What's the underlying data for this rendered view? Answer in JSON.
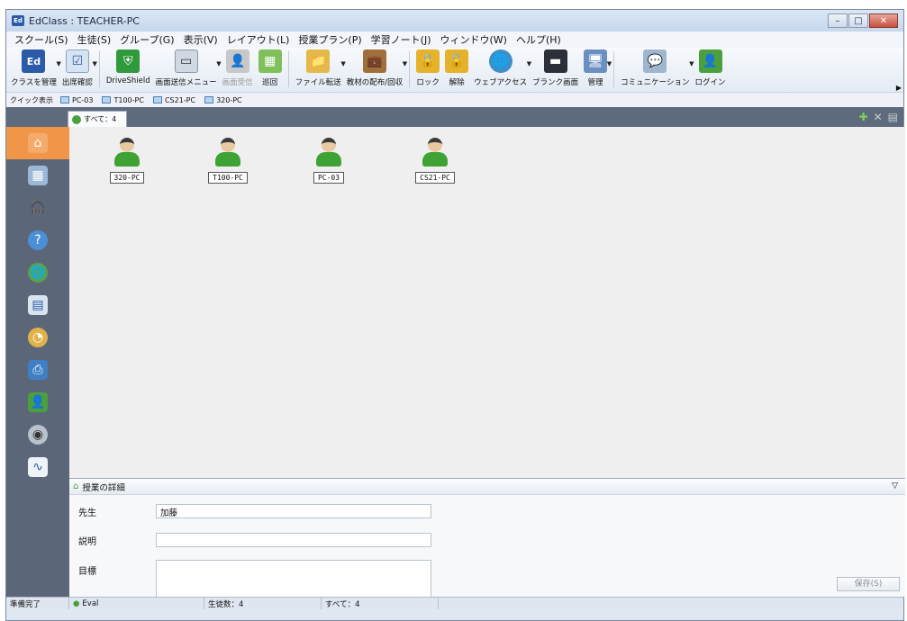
{
  "window": {
    "title": "EdClass : TEACHER-PC",
    "app_icon": "Ed"
  },
  "menubar": {
    "items": [
      "スクール(S)",
      "生徒(S)",
      "グループ(G)",
      "表示(V)",
      "レイアウト(L)",
      "授業プラン(P)",
      "学習ノート(J)",
      "ウィンドウ(W)",
      "ヘルプ(H)"
    ]
  },
  "toolbar": {
    "items": [
      {
        "label": "クラスを管理",
        "icon": "class-manage-icon"
      },
      {
        "label": "出席確認",
        "icon": "attendance-icon"
      },
      {
        "label": "DriveShield",
        "icon": "driveshield-icon"
      },
      {
        "label": "画面送信メニュー",
        "icon": "screen-send-icon"
      },
      {
        "label": "画面受信",
        "icon": "screen-receive-icon"
      },
      {
        "label": "巡回",
        "icon": "patrol-icon"
      },
      {
        "label": "ファイル転送",
        "icon": "file-transfer-icon"
      },
      {
        "label": "教材の配布/回収",
        "icon": "material-icon"
      },
      {
        "label": "ロック",
        "icon": "lock-icon"
      },
      {
        "label": "解除",
        "icon": "unlock-icon"
      },
      {
        "label": "ウェブアクセス",
        "icon": "web-access-icon"
      },
      {
        "label": "ブランク画面",
        "icon": "blank-screen-icon"
      },
      {
        "label": "管理",
        "icon": "manage-icon"
      },
      {
        "label": "コミュニケーション",
        "icon": "communication-icon"
      },
      {
        "label": "ログイン",
        "icon": "login-icon"
      }
    ]
  },
  "quickbar": {
    "label": "クイック表示",
    "items": [
      "PC-03",
      "T100-PC",
      "CS21-PC",
      "320-PC"
    ]
  },
  "tab": {
    "label": "すべて：4"
  },
  "students": [
    "320-PC",
    "T100-PC",
    "PC-03",
    "CS21-PC"
  ],
  "details": {
    "title": "授業の詳細",
    "teacher_label": "先生",
    "teacher_value": "加藤",
    "description_label": "説明",
    "description_value": "",
    "goal_label": "目標",
    "save_label": "保存(S)"
  },
  "statusbar": {
    "status": "準備完了",
    "license": "Eval",
    "students": "生徒数：4",
    "all": "すべて：4"
  }
}
